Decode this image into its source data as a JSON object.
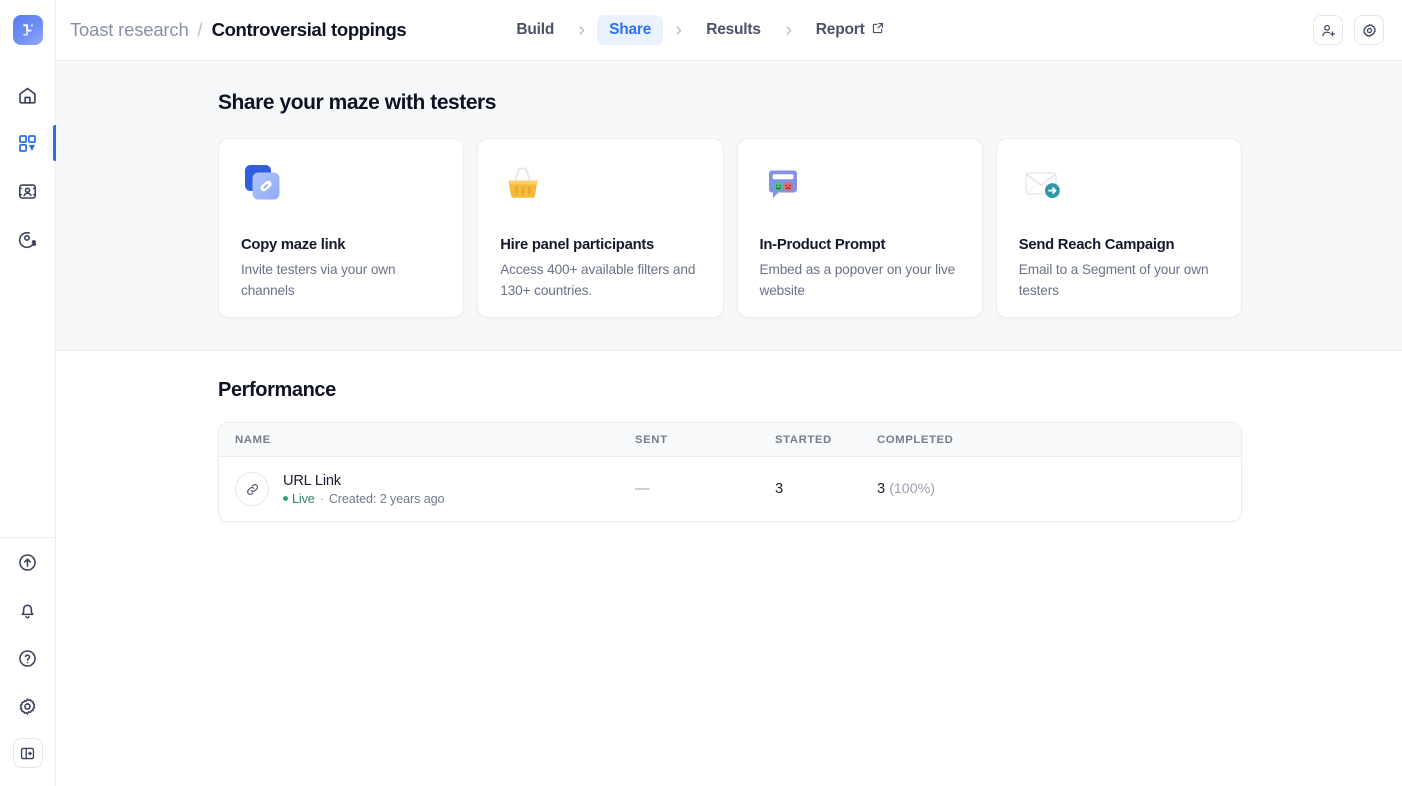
{
  "sidebar": {
    "logo_name": "maze-logo",
    "top_items": [
      {
        "name": "home",
        "label": "Home",
        "active": false
      },
      {
        "name": "projects",
        "label": "Projects",
        "active": true
      },
      {
        "name": "panel",
        "label": "Panel",
        "active": false
      },
      {
        "name": "credits",
        "label": "Credits",
        "active": false
      }
    ],
    "bottom_items": [
      {
        "name": "upgrade",
        "label": "Upgrade"
      },
      {
        "name": "notifications",
        "label": "Notifications"
      },
      {
        "name": "help",
        "label": "Help"
      },
      {
        "name": "settings",
        "label": "Settings"
      }
    ],
    "collapse_label": "Collapse sidebar"
  },
  "topbar": {
    "breadcrumb": {
      "parent": "Toast research",
      "separator": "/",
      "current": "Controversial toppings"
    },
    "steps": [
      {
        "label": "Build",
        "active": false,
        "external": false
      },
      {
        "label": "Share",
        "active": true,
        "external": false
      },
      {
        "label": "Results",
        "active": false,
        "external": false
      },
      {
        "label": "Report",
        "active": false,
        "external": true
      }
    ],
    "actions": [
      {
        "name": "invite-member-button",
        "label": "Invite member"
      },
      {
        "name": "settings-button",
        "label": "Settings"
      }
    ]
  },
  "share": {
    "title": "Share your maze with testers",
    "cards": [
      {
        "icon": "copy-link-icon",
        "title": "Copy maze link",
        "desc": "Invite testers via your own channels"
      },
      {
        "icon": "shopping-basket-icon",
        "title": "Hire panel participants",
        "desc": "Access 400+ available filters and 130+ countries."
      },
      {
        "icon": "in-product-prompt-icon",
        "title": "In-Product Prompt",
        "desc": "Embed as a popover on your live website"
      },
      {
        "icon": "email-send-icon",
        "title": "Send Reach Campaign",
        "desc": "Email to a Segment of your own testers"
      }
    ]
  },
  "performance": {
    "title": "Performance",
    "columns": [
      "NAME",
      "SENT",
      "STARTED",
      "COMPLETED"
    ],
    "rows": [
      {
        "icon": "link-icon",
        "name": "URL Link",
        "status": "Live",
        "sub_separator": "·",
        "created": "Created: 2 years ago",
        "sent": "—",
        "started": "3",
        "completed": "3",
        "completed_pct": "(100%)"
      }
    ]
  },
  "colors": {
    "accent_blue": "#2b74f0",
    "accent_pill": "#eaf2fe",
    "live_green": "#2e8568",
    "page_bg": "#f7f8fa",
    "text_dark": "#0f1222",
    "text_muted": "#6b7285"
  }
}
